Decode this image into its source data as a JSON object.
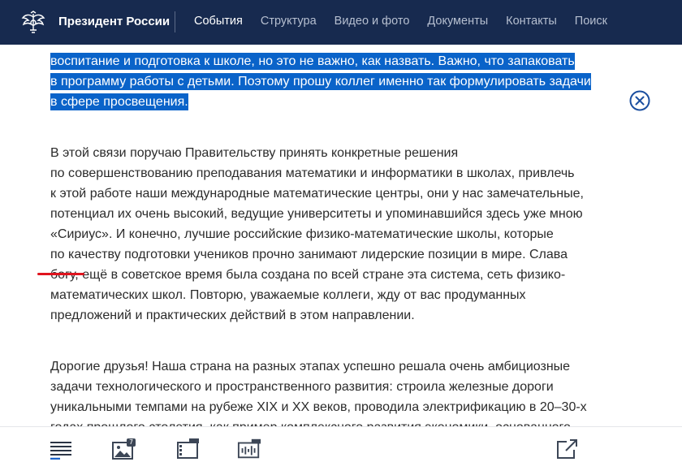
{
  "header": {
    "site_title": "Президент России",
    "nav": [
      {
        "label": "События",
        "active": true
      },
      {
        "label": "Структура",
        "active": false
      },
      {
        "label": "Видео и фото",
        "active": false
      },
      {
        "label": "Документы",
        "active": false
      },
      {
        "label": "Контакты",
        "active": false
      },
      {
        "label": "Поиск",
        "active": false
      }
    ]
  },
  "article": {
    "para_highlighted": [
      "воспитание и подготовка к школе, но это не важно, как назвать. Важно, что запаковать",
      "в программу работы с детьми. Поэтому прошу коллег именно так формулировать задачи",
      "в сфере просвещения."
    ],
    "para_2": [
      "В этой связи поручаю Правительству принять конкретные решения",
      "по совершенствованию преподавания математики и информатики в школах, привлечь",
      "к этой работе наши международные математические центры, они у нас замечательные,",
      "потенциал их очень высокий, ведущие университеты и упоминавшийся здесь уже мною",
      "«Сириус». И конечно, лучшие российские физико-математические школы, которые",
      "по качеству подготовки учеников прочно занимают лидерские позиции в мире. Слава",
      "богу, ещё в советское время была создана по всей стране эта система, сеть физико-",
      "математических школ. Повторю, уважаемые коллеги, жду от вас продуманных",
      "предложений и практических действий в этом направлении."
    ],
    "para_3": [
      "Дорогие друзья! Наша страна на разных этапах успешно решала очень амбициозные",
      "задачи технологического и пространственного развития: строила железные дороги",
      "уникальными темпами на рубеже XIX и XX веков, проводила электрификацию в 20–30-х",
      "годах прошлого столетия, как пример комплексного развития экономики, основанного"
    ]
  },
  "toolbar": {
    "photo_count": "7"
  },
  "colors": {
    "header_bg": "#172a4f",
    "selection": "#0a63c9",
    "accent_red": "#e0141e",
    "icon": "#3c4656"
  }
}
